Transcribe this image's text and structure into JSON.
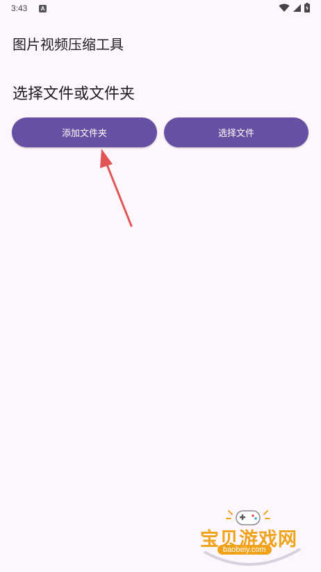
{
  "status_bar": {
    "time": "3:43",
    "app_icon_letter": "A",
    "icons": [
      "wifi-icon",
      "signal-icon",
      "battery-icon"
    ]
  },
  "app": {
    "title": "图片视频压缩工具"
  },
  "main": {
    "subtitle": "选择文件或文件夹",
    "add_folder_label": "添加文件夹",
    "select_file_label": "选择文件"
  },
  "watermark": {
    "brand": "宝贝游戏网",
    "url": "baobeiy.com"
  },
  "colors": {
    "background": "#fdf7fd",
    "button": "#674fa3",
    "button_text": "#ffffff",
    "annotation_arrow": "#e05555",
    "watermark": "#f0a21a"
  }
}
